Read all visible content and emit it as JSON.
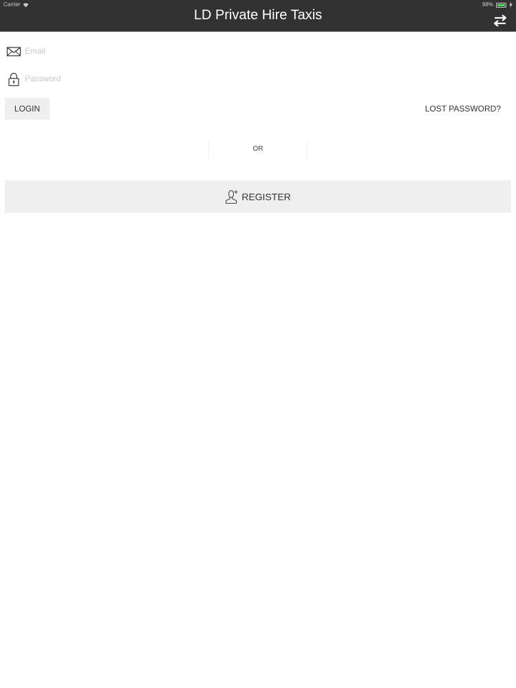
{
  "status_bar": {
    "carrier": "Carrier",
    "battery": "98%",
    "battery_level": 0.98
  },
  "header": {
    "title": "LD Private Hire Taxis",
    "swap_icon": "swap-arrows-icon"
  },
  "form": {
    "email": {
      "placeholder": "Email",
      "value": "",
      "icon": "envelope-icon"
    },
    "password": {
      "placeholder": "Password",
      "value": "",
      "icon": "lock-icon"
    },
    "login_label": "LOGIN",
    "lost_password_label": "LOST PASSWORD?",
    "or_label": "OR",
    "register_label": "REGISTER",
    "register_icon": "add-user-icon"
  },
  "colors": {
    "header_bg": "#333232",
    "button_bg": "#efeff0",
    "text": "#333333"
  }
}
